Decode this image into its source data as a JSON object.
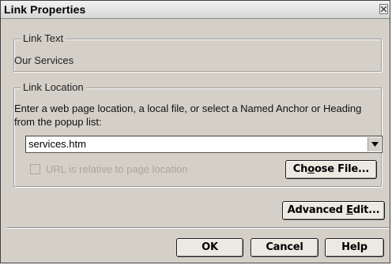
{
  "window": {
    "title": "Link Properties"
  },
  "link_text": {
    "legend": "Link Text",
    "value": "Our Services"
  },
  "link_location": {
    "legend": "Link Location",
    "instructions": "Enter a web page location, a local file, or select a Named Anchor or Heading from the popup list:",
    "url_value": "services.htm",
    "relative_label": "URL is relative to page location",
    "relative_checked": false,
    "relative_enabled": false
  },
  "buttons": {
    "choose_file": {
      "pre": "Ch",
      "accel": "o",
      "post": "ose File..."
    },
    "advanced_edit": {
      "pre": "Advanced ",
      "accel": "E",
      "post": "dit..."
    },
    "ok": "OK",
    "cancel": "Cancel",
    "help": "Help"
  },
  "icons": {
    "close": "close-icon",
    "dropdown": "chevron-down-icon"
  }
}
